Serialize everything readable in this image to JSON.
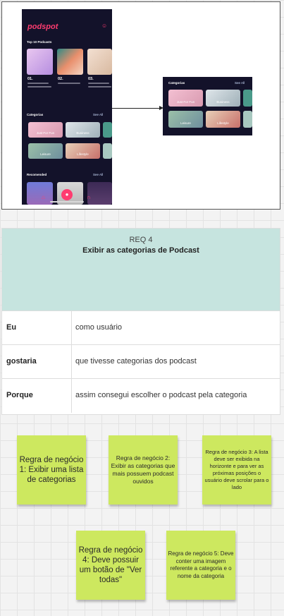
{
  "phone": {
    "logo": "podspot",
    "user_icon": "user-icon",
    "top_label": "Top 10 Podcasts",
    "top_items": [
      "01.",
      "02.",
      "03."
    ],
    "categories_label": "Categorias",
    "see_all": "See All",
    "categories": [
      "Just For Fun",
      "Business",
      "Leisure",
      "Lifestyle"
    ],
    "recommended_label": "Recomended",
    "nav_icons": [
      "home-icon",
      "mic-icon",
      "headphones-icon"
    ]
  },
  "card": {
    "title": "Categorias",
    "see_all": "See All",
    "categories": [
      "Just For Fun",
      "Business",
      "Leisure",
      "Lifestyle"
    ]
  },
  "requirement": {
    "number": "REQ 4",
    "title": "Exibir as categorias de Podcast",
    "rows": [
      {
        "key": "Eu",
        "value": "como usuário"
      },
      {
        "key": "gostaria",
        "value": "que tivesse categorias dos podcast"
      },
      {
        "key": "Porque",
        "value": "assim consegui escolher o podcast pela categoria"
      }
    ]
  },
  "notes": [
    "Regra de negócio 1: Exibir uma lista de categorias",
    "Regra de negócio 2: Exibir as categorias que mais possuem podcast ouvidos",
    "Regra de negócio 3: A lista deve ser exibida na horizonte e para ver as próximas posições o usuário deve scrolar para o lado",
    "Regra de negócio 4: Deve possuir um botão de \"Ver todas\"",
    "Regra de negócio 5: Deve conter uma imagem referente a categoria e o nome da categoria"
  ],
  "colors": {
    "accent": "#ff3c70",
    "phone_bg": "#13122a",
    "note": "#cde85f",
    "header": "#c6e4df"
  }
}
